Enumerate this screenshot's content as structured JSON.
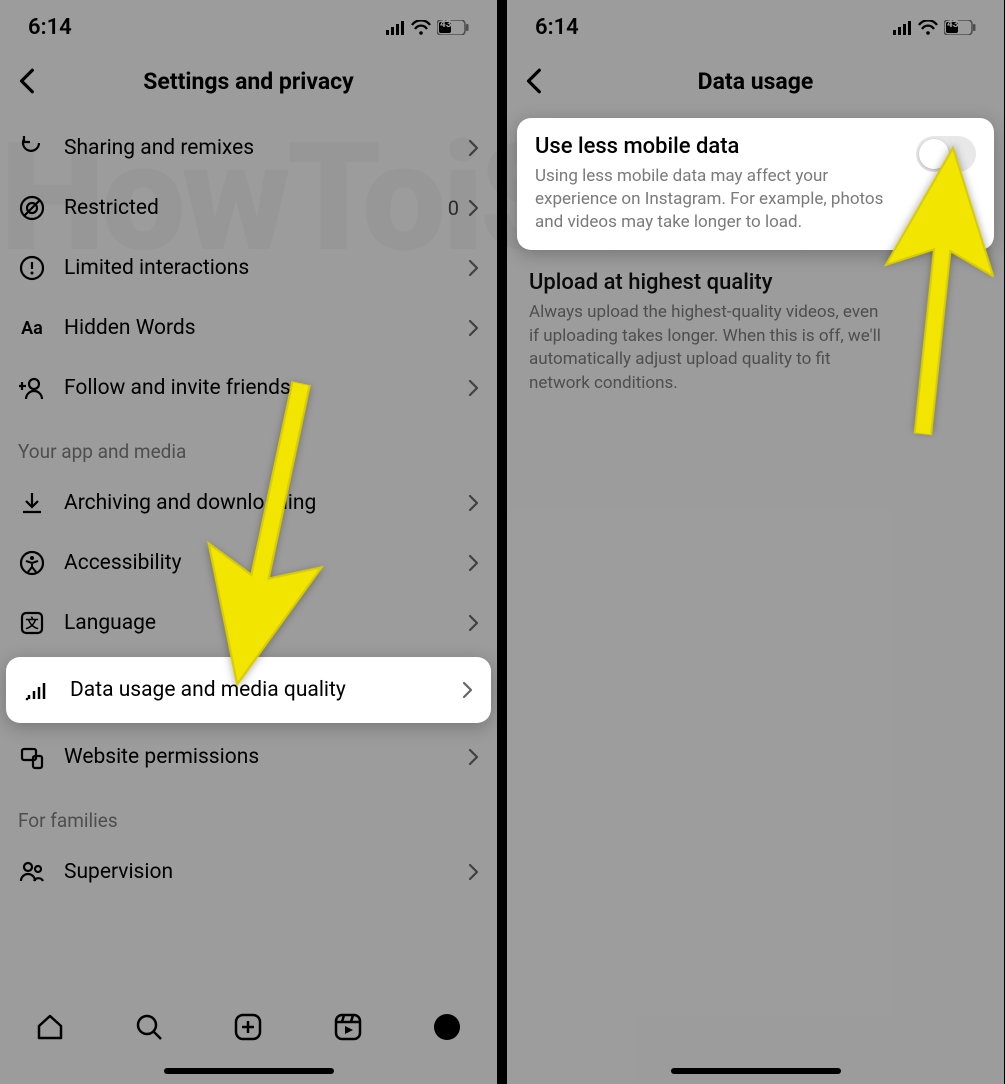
{
  "status": {
    "time": "6:14",
    "battery": "43"
  },
  "left": {
    "header": {
      "title": "Settings and privacy"
    },
    "rows": [
      {
        "icon": "refresh",
        "label": "Sharing and remixes"
      },
      {
        "icon": "restricted",
        "label": "Restricted",
        "badge": "0"
      },
      {
        "icon": "alert",
        "label": "Limited interactions"
      },
      {
        "icon": "aa",
        "label": "Hidden Words"
      },
      {
        "icon": "adduser",
        "label": "Follow and invite friends"
      }
    ],
    "section1": "Your app and media",
    "rows2": [
      {
        "icon": "download",
        "label": "Archiving and downloading"
      },
      {
        "icon": "accessibility",
        "label": "Accessibility"
      },
      {
        "icon": "language",
        "label": "Language"
      },
      {
        "icon": "signal",
        "label": "Data usage and media quality",
        "highlight": true
      },
      {
        "icon": "website",
        "label": "Website permissions"
      }
    ],
    "section2": "For families",
    "rows3": [
      {
        "icon": "supervision",
        "label": "Supervision"
      }
    ]
  },
  "right": {
    "header": {
      "title": "Data usage"
    },
    "card": {
      "title": "Use less mobile data",
      "desc": "Using less mobile data may affect your experience on Instagram. For example, photos and videos may take longer to load."
    },
    "block2": {
      "title": "Upload at highest quality",
      "desc": "Always upload the highest-quality videos, even if uploading takes longer. When this is off, we'll automatically adjust upload quality to fit network conditions."
    }
  },
  "watermark": "HowToiSolve"
}
